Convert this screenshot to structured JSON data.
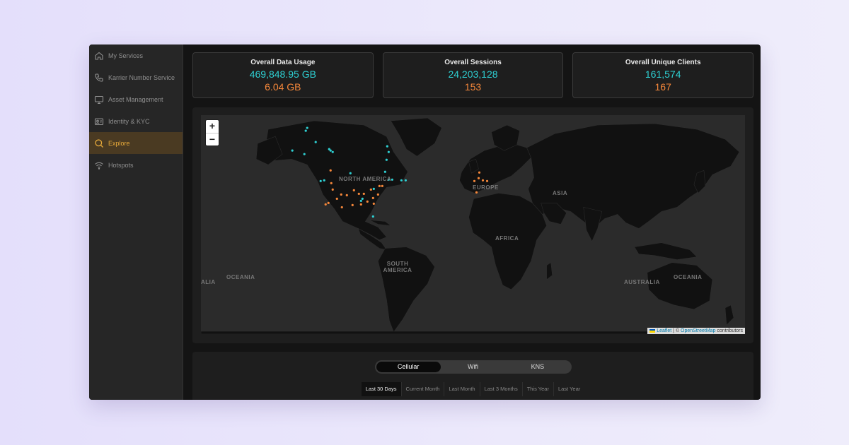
{
  "sidebar": {
    "items": [
      {
        "label": "My Services",
        "icon": "home-icon"
      },
      {
        "label": "Karrier Number Service",
        "icon": "phone-icon"
      },
      {
        "label": "Asset Management",
        "icon": "monitor-icon"
      },
      {
        "label": "Identity & KYC",
        "icon": "id-card-icon"
      },
      {
        "label": "Explore",
        "icon": "search-icon",
        "active": true
      },
      {
        "label": "Hotspots",
        "icon": "wifi-icon"
      }
    ]
  },
  "stats": [
    {
      "title": "Overall Data Usage",
      "value_primary": "469,848.95 GB",
      "value_secondary": "6.04 GB"
    },
    {
      "title": "Overall Sessions",
      "value_primary": "24,203,128",
      "value_secondary": "153"
    },
    {
      "title": "Overall Unique Clients",
      "value_primary": "161,574",
      "value_secondary": "167"
    }
  ],
  "colors": {
    "primary": "#2ecfd2",
    "secondary": "#f5873a",
    "accent": "#e6a93a"
  },
  "map": {
    "zoom_in": "+",
    "zoom_out": "−",
    "labels": {
      "north_america": "NORTH AMERICA",
      "europe": "EUROPE",
      "asia": "ASIA",
      "africa": "AFRICA",
      "south_america": "SOUTH AMERICA",
      "australia": "AUSTRALIA",
      "oceania_left": "OCEANIA",
      "oceania_right": "OCEANIA",
      "left_edge": "ALIA"
    },
    "attribution": {
      "leaflet": "Leaflet",
      "sep": " | © ",
      "osm": "OpenStreetMap",
      "suffix": " contributors"
    }
  },
  "network_tabs": [
    {
      "label": "Cellular",
      "active": true
    },
    {
      "label": "Wifi"
    },
    {
      "label": "KNS"
    }
  ],
  "periods": [
    {
      "label": "Last 30 Days",
      "active": true
    },
    {
      "label": "Current Month"
    },
    {
      "label": "Last Month"
    },
    {
      "label": "Last 3 Months"
    },
    {
      "label": "This Year"
    },
    {
      "label": "Last Year"
    }
  ]
}
